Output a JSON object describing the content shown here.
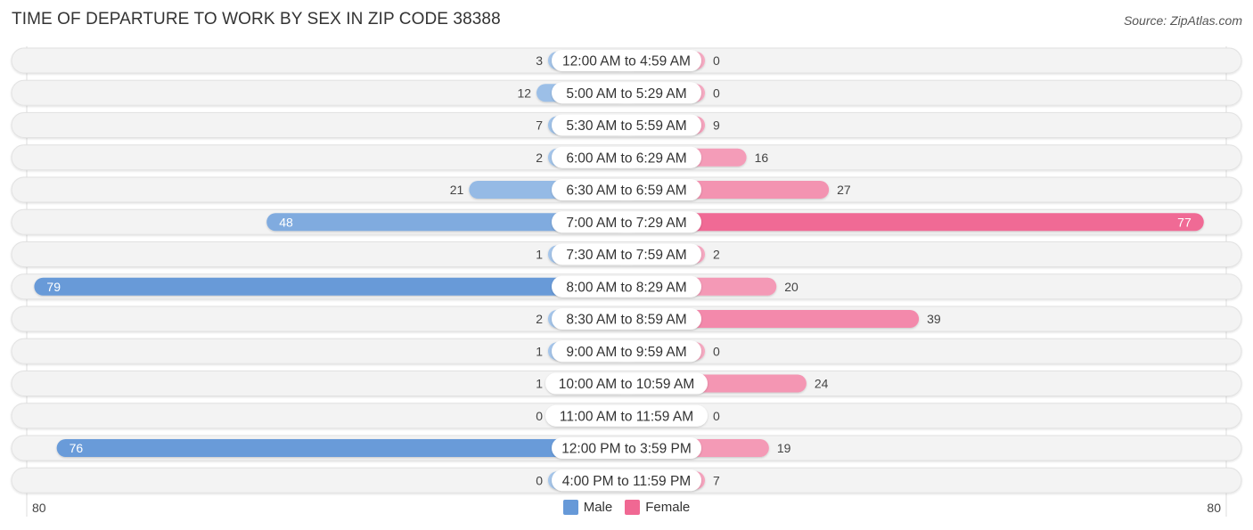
{
  "header": {
    "title": "TIME OF DEPARTURE TO WORK BY SEX IN ZIP CODE 38388",
    "source": "Source: ZipAtlas.com"
  },
  "colors": {
    "male_light": "#a6c6ea",
    "male_strong": "#6699d8",
    "female_light": "#f5a9c1",
    "female_strong": "#f06893",
    "row_bg": "#f3f3f3",
    "label_bg": "#ffffff"
  },
  "chart_data": {
    "type": "bar",
    "orientation": "horizontal-diverging",
    "title": "TIME OF DEPARTURE TO WORK BY SEX IN ZIP CODE 38388",
    "categories": [
      "12:00 AM to 4:59 AM",
      "5:00 AM to 5:29 AM",
      "5:30 AM to 5:59 AM",
      "6:00 AM to 6:29 AM",
      "6:30 AM to 6:59 AM",
      "7:00 AM to 7:29 AM",
      "7:30 AM to 7:59 AM",
      "8:00 AM to 8:29 AM",
      "8:30 AM to 8:59 AM",
      "9:00 AM to 9:59 AM",
      "10:00 AM to 10:59 AM",
      "11:00 AM to 11:59 AM",
      "12:00 PM to 3:59 PM",
      "4:00 PM to 11:59 PM"
    ],
    "series": [
      {
        "name": "Male",
        "values": [
          3,
          12,
          7,
          2,
          21,
          48,
          1,
          79,
          2,
          1,
          1,
          0,
          76,
          0
        ]
      },
      {
        "name": "Female",
        "values": [
          0,
          0,
          9,
          16,
          27,
          77,
          2,
          20,
          39,
          0,
          24,
          0,
          19,
          7
        ]
      }
    ],
    "xlim": [
      -80,
      80
    ],
    "axis_tick_labels": {
      "left": "80",
      "right": "80"
    },
    "legend": {
      "position": "bottom-center",
      "entries": [
        "Male",
        "Female"
      ]
    },
    "grid": false
  }
}
